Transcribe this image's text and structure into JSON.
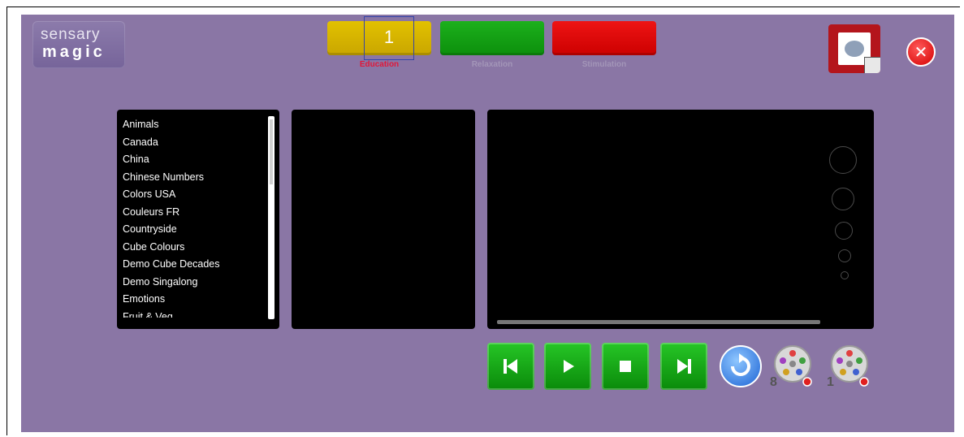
{
  "logo": {
    "line1": "sensary",
    "line2": "magic"
  },
  "modes": [
    {
      "label": "Education",
      "color": "#d6b400"
    },
    {
      "label": "Relaxation",
      "color": "#12a012"
    },
    {
      "label": "Stimulation",
      "color": "#e00000"
    }
  ],
  "overlay_marker": "1",
  "playlist": [
    "Animals",
    "Canada",
    "China",
    "Chinese Numbers",
    "Colors USA",
    "Couleurs FR",
    "Countryside",
    "Cube Colours",
    "Demo Cube Decades",
    "Demo Singalong",
    "Emotions",
    "Fruit & Veg"
  ],
  "reels": [
    {
      "badge": "8"
    },
    {
      "badge": "1"
    }
  ],
  "icons": {
    "close": "close-icon",
    "theatre": "theatre-edit-icon",
    "prev": "skip-previous-icon",
    "play": "play-icon",
    "stop": "stop-icon",
    "next": "skip-next-icon",
    "repeat": "repeat-icon",
    "reel": "film-reel-icon"
  }
}
